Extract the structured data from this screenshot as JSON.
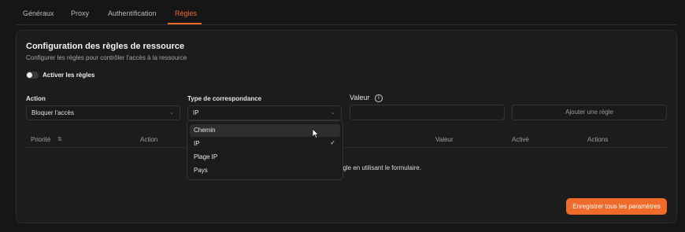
{
  "tabs": [
    {
      "label": "Généraux",
      "active": false
    },
    {
      "label": "Proxy",
      "active": false
    },
    {
      "label": "Authentification",
      "active": false
    },
    {
      "label": "Règles",
      "active": true
    }
  ],
  "section": {
    "title": "Configuration des règles de ressource",
    "subtitle": "Configurer les règles pour contrôler l'accès à la ressource"
  },
  "toggle": {
    "label": "Activer les règles",
    "on": false
  },
  "form": {
    "action": {
      "label": "Action",
      "value": "Bloquer l'accès"
    },
    "match_type": {
      "label": "Type de correspondance",
      "value": "IP"
    },
    "value": {
      "label": "Valeur",
      "value": ""
    },
    "add_button": "Ajouter une règle"
  },
  "dropdown": {
    "options": [
      {
        "label": "Chemin",
        "highlighted": true,
        "selected": false
      },
      {
        "label": "IP",
        "highlighted": false,
        "selected": true
      },
      {
        "label": "Plage IP",
        "highlighted": false,
        "selected": false
      },
      {
        "label": "Pays",
        "highlighted": false,
        "selected": false
      }
    ]
  },
  "table": {
    "headers": [
      "Priorité",
      "Action",
      "Valeur",
      "Activé",
      "Actions"
    ],
    "empty_text": "ègle en utilisant le formulaire."
  },
  "save_button": "Enregistrer tous les paramètres",
  "icons": {
    "sort": "sort-arrows-icon",
    "info": "info-icon",
    "chevron": "chevron-down-icon",
    "check": "check-icon"
  },
  "colors": {
    "accent": "#f06a2a",
    "background": "#161616",
    "card": "#1c1c1c"
  }
}
